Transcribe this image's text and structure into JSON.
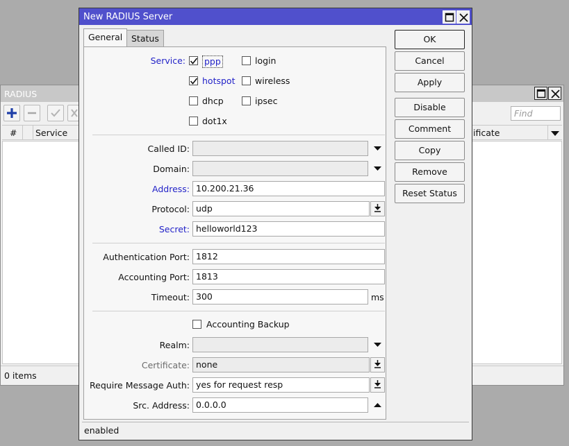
{
  "background_window": {
    "title": "RADIUS",
    "find_placeholder": "Find",
    "columns": [
      "#",
      "Service",
      "ificate"
    ],
    "status": "0 items"
  },
  "dialog": {
    "title": "New RADIUS Server",
    "tabs": [
      {
        "label": "General",
        "active": true
      },
      {
        "label": "Status",
        "active": false
      }
    ],
    "service": {
      "label": "Service:",
      "options": [
        {
          "label": "ppp",
          "checked": true
        },
        {
          "label": "login",
          "checked": false
        },
        {
          "label": "hotspot",
          "checked": true
        },
        {
          "label": "wireless",
          "checked": false
        },
        {
          "label": "dhcp",
          "checked": false
        },
        {
          "label": "ipsec",
          "checked": false
        },
        {
          "label": "dot1x",
          "checked": false
        }
      ]
    },
    "fields": {
      "called_id": {
        "label": "Called ID:",
        "value": ""
      },
      "domain": {
        "label": "Domain:",
        "value": ""
      },
      "address": {
        "label": "Address:",
        "value": "10.200.21.36"
      },
      "protocol": {
        "label": "Protocol:",
        "value": "udp"
      },
      "secret": {
        "label": "Secret:",
        "value": "helloworld123"
      },
      "auth_port": {
        "label": "Authentication Port:",
        "value": "1812"
      },
      "acct_port": {
        "label": "Accounting Port:",
        "value": "1813"
      },
      "timeout": {
        "label": "Timeout:",
        "value": "300",
        "unit": "ms"
      },
      "accounting_backup": {
        "label": "Accounting Backup",
        "checked": false
      },
      "realm": {
        "label": "Realm:",
        "value": ""
      },
      "certificate": {
        "label": "Certificate:",
        "value": "none"
      },
      "require_message_auth": {
        "label": "Require Message Auth:",
        "value": "yes for request resp"
      },
      "src_address": {
        "label": "Src. Address:",
        "value": "0.0.0.0"
      }
    },
    "buttons": {
      "ok": "OK",
      "cancel": "Cancel",
      "apply": "Apply",
      "disable": "Disable",
      "comment": "Comment",
      "copy": "Copy",
      "remove": "Remove",
      "reset_status": "Reset Status"
    },
    "status": "enabled"
  },
  "colors": {
    "title_active": "#5050cc",
    "label_blue": "#2323c8",
    "add_icon": "#1f3fa8"
  }
}
